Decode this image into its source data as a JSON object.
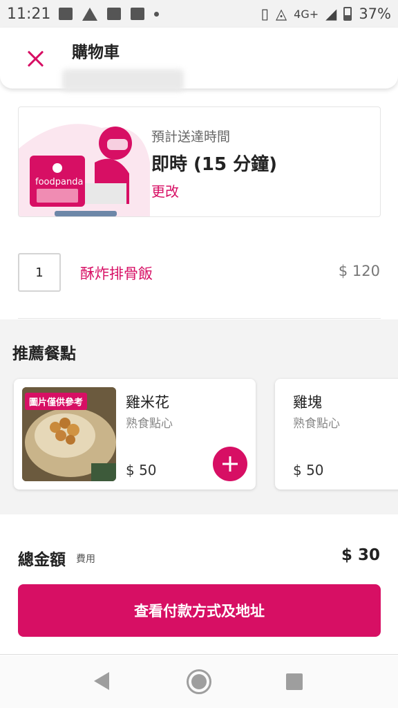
{
  "status_bar": {
    "time": "11:21",
    "network": "4G+",
    "battery": "37%",
    "icons": [
      "image-icon",
      "warning-icon",
      "cast-icon",
      "message-icon",
      "dot-icon",
      "vibrate-icon",
      "wifi-icon",
      "signal-icon",
      "battery-icon"
    ]
  },
  "header": {
    "title": "購物車",
    "close_icon": "close-icon"
  },
  "delivery": {
    "label": "預計送達時間",
    "value": "即時 (15 分鐘)",
    "change_link": "更改",
    "brand": "foodpanda"
  },
  "cart_item": {
    "quantity": "1",
    "name": "酥炸排骨飯",
    "price": "$ 120"
  },
  "recommended": {
    "title": "推薦餐點",
    "items": [
      {
        "name": "雞米花",
        "category": "熟食點心",
        "price": "$ 50",
        "image_badge": "圖片僅供參考"
      },
      {
        "name": "雞塊",
        "category": "熟食點心",
        "price": "$ 50"
      }
    ]
  },
  "summary": {
    "total_label": "總金額",
    "fee_label": "費用",
    "total_value": "$ 30"
  },
  "checkout": {
    "button_label": "查看付款方式及地址"
  },
  "colors": {
    "accent": "#d70f64",
    "background": "#ffffff",
    "section_bg": "#f3f3f3"
  },
  "nav_bar": {
    "icons": [
      "back-icon",
      "home-icon",
      "recent-apps-icon"
    ]
  }
}
